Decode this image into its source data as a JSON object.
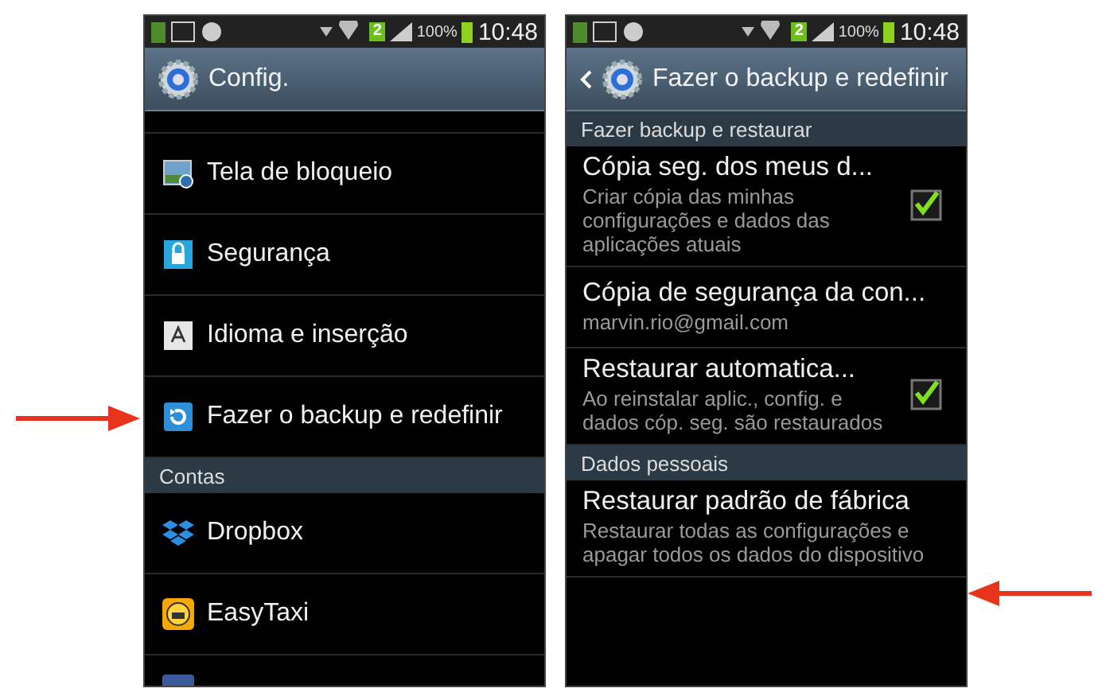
{
  "screens": [
    {
      "status_bar": {
        "sim_badge": "2",
        "battery_percent": "100%",
        "time": "10:48"
      },
      "header": {
        "kind": "main",
        "title": "Config."
      },
      "rows": [
        {
          "kind": "item",
          "title": "Tela de bloqueio"
        },
        {
          "kind": "item",
          "title": "Segurança"
        },
        {
          "kind": "item",
          "title": "Idioma e inserção"
        },
        {
          "kind": "item",
          "title": "Fazer o backup e redefinir"
        },
        {
          "kind": "section",
          "title": "Contas"
        },
        {
          "kind": "item",
          "title": "Dropbox"
        },
        {
          "kind": "item",
          "title": "EasyTaxi"
        },
        {
          "kind": "partial"
        }
      ]
    },
    {
      "status_bar": {
        "sim_badge": "2",
        "battery_percent": "100%",
        "time": "10:48"
      },
      "header": {
        "kind": "sub",
        "title": "Fazer o backup e redefinir"
      },
      "rows": [
        {
          "kind": "section",
          "title": "Fazer backup e restaurar"
        },
        {
          "kind": "setting",
          "title": "Cópia seg. dos meus d...",
          "summary": "Criar cópia das minhas configurações e dados das aplicações atuais",
          "checked": true
        },
        {
          "kind": "setting",
          "title": "Cópia de segurança da con...",
          "summary": "marvin.rio@gmail.com"
        },
        {
          "kind": "setting",
          "title": "Restaurar automatica...",
          "summary": "Ao reinstalar aplic., config. e dados cóp. seg. são restaurados",
          "checked": true
        },
        {
          "kind": "section",
          "title": "Dados pessoais"
        },
        {
          "kind": "setting",
          "title": "Restaurar padrão de fábrica",
          "summary": "Restaurar todas as configurações e apagar todos os dados do dispositivo"
        }
      ]
    }
  ]
}
